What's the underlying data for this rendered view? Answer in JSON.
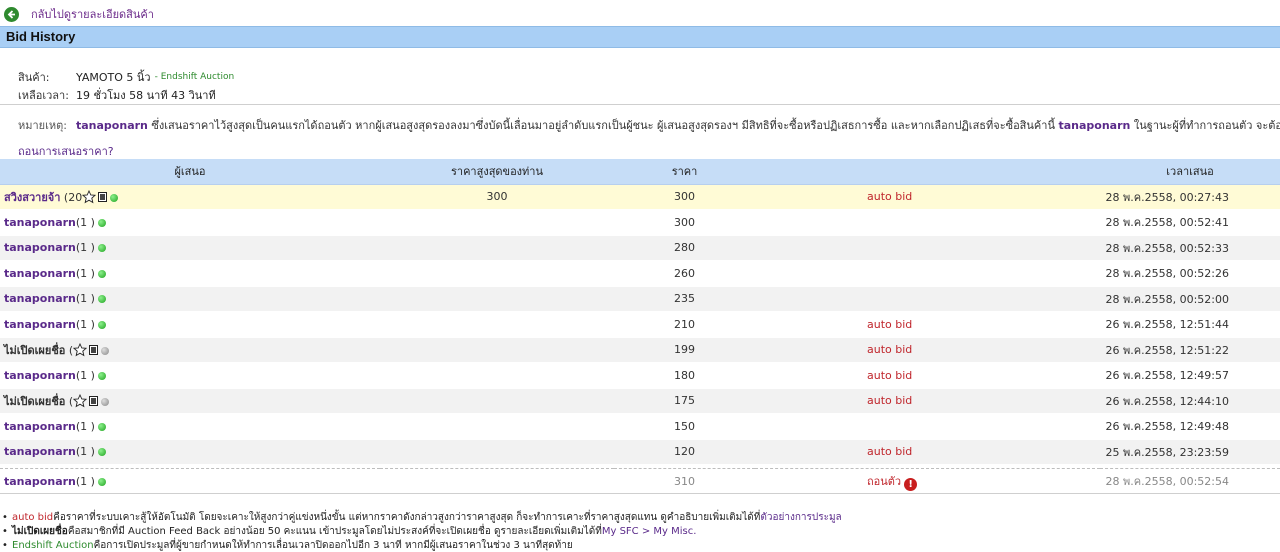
{
  "back": {
    "label": "กลับไปดูรายละเอียดสินค้า"
  },
  "title": "Bid History",
  "product": {
    "label": "สินค้า:",
    "name": "YAMOTO 5 นิ้ว",
    "tag": "- Endshift Auction"
  },
  "remaining": {
    "label": "เหลือเวลา:",
    "value": "19 ชั่วโมง 58 นาที 43 วินาที"
  },
  "remark": {
    "label": "หมายเหตุ:",
    "user": "tanaponarn",
    "text1": " ซึ่งเสนอราคาไว้สูงสุดเป็นคนแรกได้ถอนตัว หากผู้เสนอสูงสุดรองลงมาซึ่งบัดนี้เลื่อนมาอยู่ลำดับแรกเป็นผู้ชนะ ผู้เสนอสูงสุดรองฯ มีสิทธิที่จะซื้อหรือปฏิเสธการซื้อ และหากเลือกปฏิเสธที่จะซื้อสินค้านี้ ",
    "text2": " ในฐานะผู้ที่ทำการถอนตัว จะต้องเป็นผู้ซื้อสินค้า"
  },
  "retract_link": "ถอนการเสนอราคา?",
  "columns": {
    "bidder": "ผู้เสนอ",
    "max": "ราคาสูงสุดของท่าน",
    "price": "ราคา",
    "time": "เวลาเสนอ"
  },
  "bids": [
    {
      "name": "สวิงสวายจ้า",
      "count": " (20",
      "anon": false,
      "star": true,
      "badge": true,
      "online": true,
      "max": "300",
      "price": "300",
      "auto": "auto bid",
      "time": "28 พ.ค.2558, 00:27:43",
      "style": "hl"
    },
    {
      "name": "tanaponarn",
      "count": "(1 )",
      "anon": false,
      "star": false,
      "badge": false,
      "online": true,
      "max": "",
      "price": "300",
      "auto": "",
      "time": "28 พ.ค.2558, 00:52:41",
      "style": ""
    },
    {
      "name": "tanaponarn",
      "count": "(1 )",
      "anon": false,
      "star": false,
      "badge": false,
      "online": true,
      "max": "",
      "price": "280",
      "auto": "",
      "time": "28 พ.ค.2558, 00:52:33",
      "style": "alt"
    },
    {
      "name": "tanaponarn",
      "count": "(1 )",
      "anon": false,
      "star": false,
      "badge": false,
      "online": true,
      "max": "",
      "price": "260",
      "auto": "",
      "time": "28 พ.ค.2558, 00:52:26",
      "style": ""
    },
    {
      "name": "tanaponarn",
      "count": "(1 )",
      "anon": false,
      "star": false,
      "badge": false,
      "online": true,
      "max": "",
      "price": "235",
      "auto": "",
      "time": "28 พ.ค.2558, 00:52:00",
      "style": "alt"
    },
    {
      "name": "tanaponarn",
      "count": "(1 )",
      "anon": false,
      "star": false,
      "badge": false,
      "online": true,
      "max": "",
      "price": "210",
      "auto": "auto bid",
      "time": "26 พ.ค.2558, 12:51:44",
      "style": ""
    },
    {
      "name": "ไม่เปิดเผยชื่อ",
      "count": " (",
      "anon": true,
      "star": true,
      "badge": true,
      "online": false,
      "max": "",
      "price": "199",
      "auto": "auto bid",
      "time": "26 พ.ค.2558, 12:51:22",
      "style": "alt"
    },
    {
      "name": "tanaponarn",
      "count": "(1 )",
      "anon": false,
      "star": false,
      "badge": false,
      "online": true,
      "max": "",
      "price": "180",
      "auto": "auto bid",
      "time": "26 พ.ค.2558, 12:49:57",
      "style": ""
    },
    {
      "name": "ไม่เปิดเผยชื่อ",
      "count": " (",
      "anon": true,
      "star": true,
      "badge": true,
      "online": false,
      "max": "",
      "price": "175",
      "auto": "auto bid",
      "time": "26 พ.ค.2558, 12:44:10",
      "style": "alt"
    },
    {
      "name": "tanaponarn",
      "count": "(1 )",
      "anon": false,
      "star": false,
      "badge": false,
      "online": true,
      "max": "",
      "price": "150",
      "auto": "",
      "time": "26 พ.ค.2558, 12:49:48",
      "style": ""
    },
    {
      "name": "tanaponarn",
      "count": "(1 )",
      "anon": false,
      "star": false,
      "badge": false,
      "online": true,
      "max": "",
      "price": "120",
      "auto": "auto bid",
      "time": "25 พ.ค.2558, 23:23:59",
      "style": "alt"
    }
  ],
  "retracted": {
    "name": "tanaponarn",
    "count": "(1 )",
    "price": "310",
    "status": "ถอนตัว",
    "time": "28 พ.ค.2558, 00:52:54"
  },
  "notes": {
    "n1_key": "auto bid",
    "n1_text": " คือราคาที่ระบบเคาะสู้ให้อัตโนมัติ โดยจะเคาะให้สูงกว่าคู่แข่งหนึ่งขั้น แต่หากราคาดังกล่าวสูงกว่าราคาสูงสุด ก็จะทำการเคาะที่ราคาสูงสุดแทน ดูคำอธิบายเพิ่มเติมได้ที่ ",
    "n1_link": "ตัวอย่างการประมูล",
    "n2_key": "ไม่เปิดเผยชื่อ",
    "n2_text": " คือสมาชิกที่มี Auction Feed Back อย่างน้อย 50 คะแนน เข้าประมูลโดยไม่ประสงค์ที่จะเปิดเผยชื่อ ดูรายละเอียดเพิ่มเติมได้ที่ ",
    "n2_link": "My SFC > My Misc.",
    "n3_key": "Endshift Auction",
    "n3_text": " คือการเปิดประมูลที่ผู้ขายกำหนดให้ทำการเลื่อนเวลาปิดออกไปอีก 3 นาที หากมีผู้เสนอราคาในช่วง 3 นาทีสุดท้าย"
  },
  "colors": {
    "header": "#a9cff5",
    "table_header": "#c6ddf7",
    "highlight": "#fffbd6",
    "link": "#5a2a8a",
    "auto_bid": "#c0262c"
  }
}
